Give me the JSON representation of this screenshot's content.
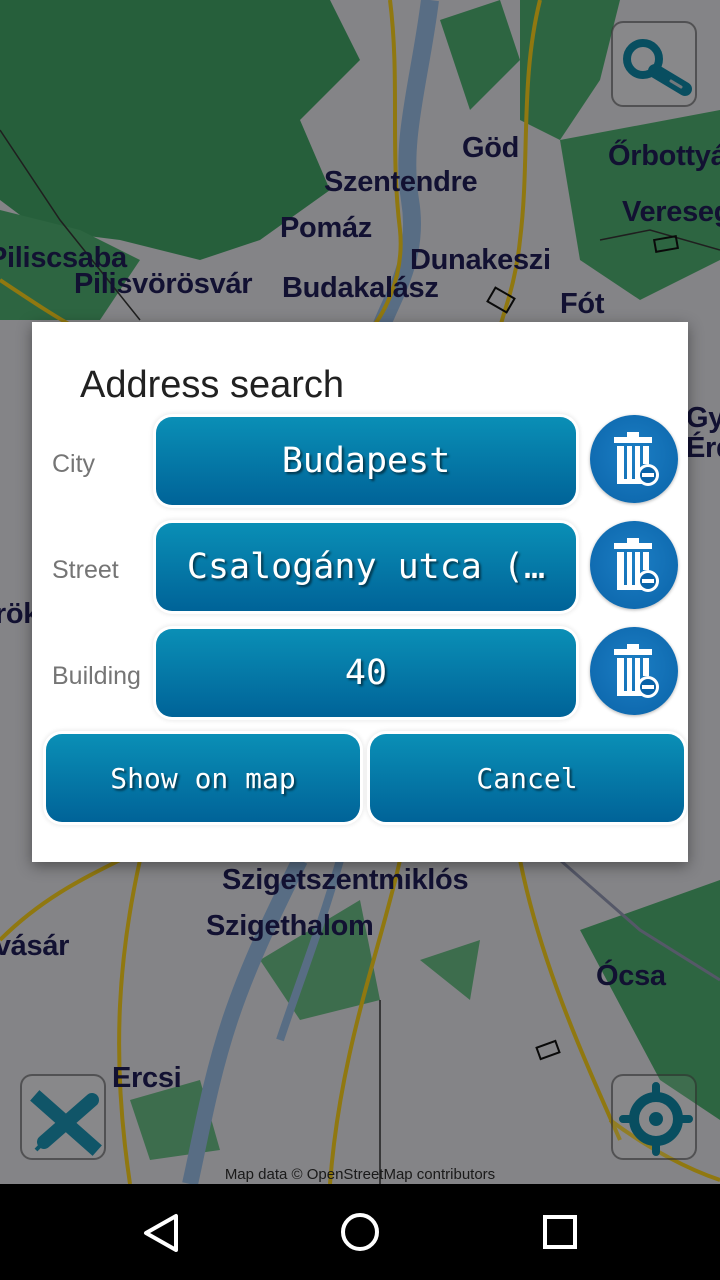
{
  "map": {
    "places": [
      {
        "name": "Göd"
      },
      {
        "name": "Őrbottyán"
      },
      {
        "name": "Szentendre"
      },
      {
        "name": "Veresegyház"
      },
      {
        "name": "Pomáz"
      },
      {
        "name": "Piliscsaba"
      },
      {
        "name": "Dunakeszi"
      },
      {
        "name": "Pilisvörösvár"
      },
      {
        "name": "Budakalász"
      },
      {
        "name": "Fót"
      },
      {
        "name": "Szigetszentmiklós"
      },
      {
        "name": "Szigethalom"
      },
      {
        "name": "Törökbálint"
      },
      {
        "name": "Ócsa"
      },
      {
        "name": "Ercsi"
      },
      {
        "name": "Gyömrő"
      },
      {
        "name": "Érd"
      },
      {
        "name": "Martonvásár"
      }
    ],
    "attribution": "Map data © OpenStreetMap contributors",
    "buttons": {
      "search": "search",
      "measure": "measure",
      "locate": "my-location"
    }
  },
  "dialog": {
    "title": "Address search",
    "fields": [
      {
        "label": "City",
        "value": "Budapest"
      },
      {
        "label": "Street",
        "value": "Csalogány utca (…"
      },
      {
        "label": "Building",
        "value": "40"
      }
    ],
    "show_on_map": "Show on map",
    "cancel": "Cancel"
  },
  "navbar": {
    "back": "back",
    "home": "home",
    "recents": "recents"
  },
  "colors": {
    "button_top": "#0a8fb6",
    "button_bottom": "#006398",
    "trash_bg": "#0a63a8",
    "place_label": "#1e1c52"
  }
}
